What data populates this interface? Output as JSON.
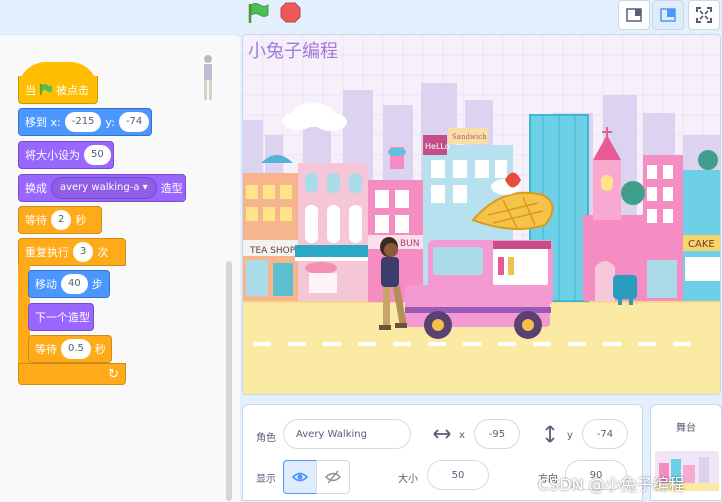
{
  "toolbar": {
    "green_flag_icon": "green-flag-icon",
    "stop_icon": "stop-icon"
  },
  "layout_buttons": [
    "small-stage-icon",
    "normal-stage-icon",
    "fullscreen-icon"
  ],
  "blocks": {
    "hat": {
      "label_pre": "当",
      "label_post": "被点击"
    },
    "goto": {
      "label": "移到 x:",
      "x": "-215",
      "y_label": "y:",
      "y": "-74"
    },
    "set_size": {
      "label": "将大小设为",
      "value": "50"
    },
    "switch_costume": {
      "label": "换成",
      "costume": "avery walking-a ▾",
      "suffix": "造型"
    },
    "wait": {
      "label": "等待",
      "value": "2",
      "unit": "秒"
    },
    "repeat": {
      "label": "重复执行",
      "count": "3",
      "unit": "次"
    },
    "move": {
      "label": "移动",
      "value": "40",
      "unit": "步"
    },
    "next_costume": {
      "label": "下一个造型"
    },
    "wait_inner": {
      "label": "等待",
      "value": "0.5",
      "unit": "秒"
    },
    "loop_arrow": "↻"
  },
  "stage": {
    "caption": "小兔子编程",
    "signs": {
      "tea_shop": "TEA SHOP",
      "hello": "HeLLo",
      "sandwich": "Sandwich",
      "bun": "BUN",
      "cake": "CAKE"
    }
  },
  "sprite_info": {
    "sprite_label": "角色",
    "sprite_name": "Avery Walking",
    "x_label": "x",
    "x_value": "-95",
    "y_label": "y",
    "y_value": "-74",
    "show_label": "显示",
    "size_label": "大小",
    "size_value": "50",
    "direction_label": "方向",
    "direction_value": "90"
  },
  "stage_panel": {
    "label": "舞台"
  },
  "watermark": "CSDN @小兔子编程",
  "colors": {
    "event": "#ffbf00",
    "motion": "#4c97ff",
    "looks": "#9966ff",
    "control": "#ffab19",
    "accent": "#855cd6"
  }
}
